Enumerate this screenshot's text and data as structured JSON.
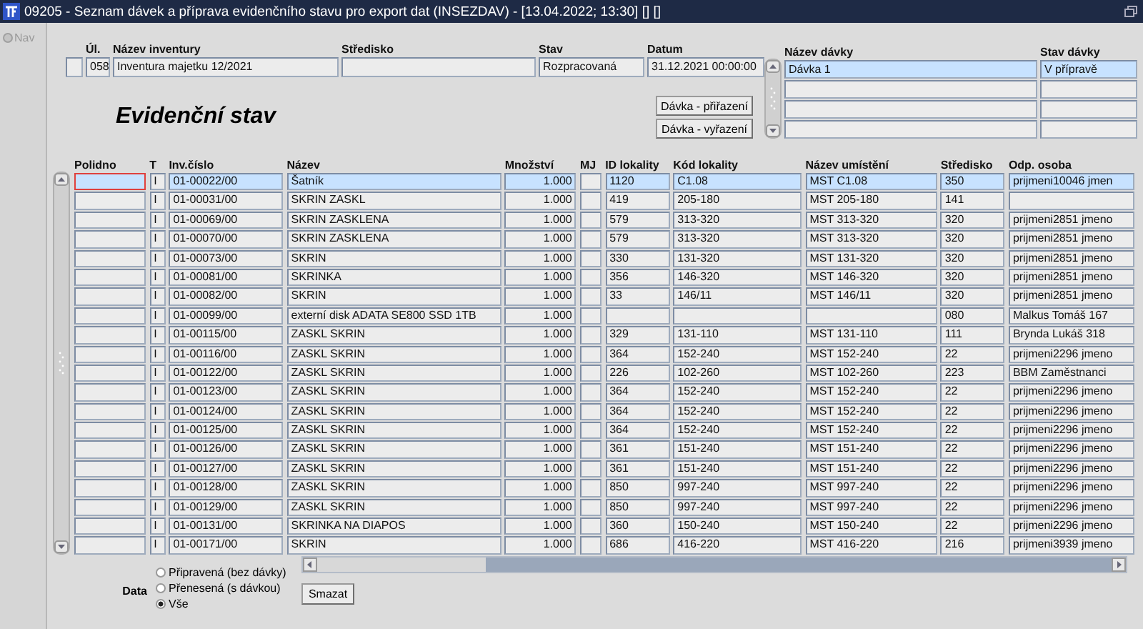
{
  "window": {
    "title": "09205 - Seznam dávek a příprava evidenčního stavu pro export dat (INSEZDAV) - [13.04.2022; 13:30] [] []"
  },
  "sidebar": {
    "items": [
      {
        "label": "Nav"
      }
    ]
  },
  "inventory": {
    "columns": [
      "Úl.",
      "Název inventury",
      "Středisko",
      "Stav",
      "Datum"
    ],
    "row": {
      "ul": "058",
      "nazev": "Inventura majetku 12/2021",
      "stav": "Rozpracovaná",
      "datum": "31.12.2021 00:00:00"
    }
  },
  "section_title": "Evidenční stav",
  "buttons": [
    "Dávka - přiřazení",
    "Dávka - vyřazení"
  ],
  "batches": {
    "columns": [
      "Název dávky",
      "Stav dávky"
    ],
    "rows": [
      {
        "name": "Dávka 1",
        "status": "V přípravě",
        "selected": true
      }
    ]
  },
  "table": {
    "columns": [
      "Polidno",
      "T",
      "Inv.číslo",
      "Název",
      "Množství",
      "MJ",
      "ID lokality",
      "Kód lokality",
      "Název umístění",
      "Středisko",
      "Odp. osoba"
    ],
    "rows": [
      {
        "selected": true,
        "t": "I",
        "inv_cislo": "01-00022/00",
        "nazev": "Šatník",
        "mnozstvi": "1.000",
        "id_lokality": "1120",
        "kod_lokality": "C1.08",
        "nazev_umisteni": "MST C1.08",
        "stredisko": "350",
        "odp_osoba": "prijmeni10046 jmen"
      },
      {
        "selected": false,
        "t": "I",
        "inv_cislo": "01-00031/00",
        "nazev": "SKRIN ZASKL",
        "mnozstvi": "1.000",
        "id_lokality": "419",
        "kod_lokality": "205-180",
        "nazev_umisteni": "MST 205-180",
        "stredisko": "141"
      },
      {
        "selected": false,
        "t": "I",
        "inv_cislo": "01-00069/00",
        "nazev": "SKRIN ZASKLENA",
        "mnozstvi": "1.000",
        "id_lokality": "579",
        "kod_lokality": "313-320",
        "nazev_umisteni": "MST 313-320",
        "stredisko": "320",
        "odp_osoba": "prijmeni2851 jmeno"
      },
      {
        "selected": false,
        "t": "I",
        "inv_cislo": "01-00070/00",
        "nazev": "SKRIN ZASKLENA",
        "mnozstvi": "1.000",
        "id_lokality": "579",
        "kod_lokality": "313-320",
        "nazev_umisteni": "MST 313-320",
        "stredisko": "320",
        "odp_osoba": "prijmeni2851 jmeno"
      },
      {
        "selected": false,
        "t": "I",
        "inv_cislo": "01-00073/00",
        "nazev": "SKRIN",
        "mnozstvi": "1.000",
        "id_lokality": "330",
        "kod_lokality": "131-320",
        "nazev_umisteni": "MST 131-320",
        "stredisko": "320",
        "odp_osoba": "prijmeni2851 jmeno"
      },
      {
        "selected": false,
        "t": "I",
        "inv_cislo": "01-00081/00",
        "nazev": "SKRINKA",
        "mnozstvi": "1.000",
        "id_lokality": "356",
        "kod_lokality": "146-320",
        "nazev_umisteni": "MST 146-320",
        "stredisko": "320",
        "odp_osoba": "prijmeni2851 jmeno"
      },
      {
        "selected": false,
        "t": "I",
        "inv_cislo": "01-00082/00",
        "nazev": "SKRIN",
        "mnozstvi": "1.000",
        "id_lokality": "33",
        "kod_lokality": "146/11",
        "nazev_umisteni": "MST 146/11",
        "stredisko": "320",
        "odp_osoba": "prijmeni2851 jmeno"
      },
      {
        "selected": false,
        "t": "I",
        "inv_cislo": "01-00099/00",
        "nazev": "externí disk ADATA SE800 SSD 1TB",
        "mnozstvi": "1.000",
        "stredisko": "080",
        "odp_osoba": "Malkus Tomáš 167"
      },
      {
        "selected": false,
        "t": "I",
        "inv_cislo": "01-00115/00",
        "nazev": "ZASKL SKRIN",
        "mnozstvi": "1.000",
        "id_lokality": "329",
        "kod_lokality": "131-110",
        "nazev_umisteni": "MST 131-110",
        "stredisko": "111",
        "odp_osoba": "Brynda Lukáš 318"
      },
      {
        "selected": false,
        "t": "I",
        "inv_cislo": "01-00116/00",
        "nazev": "ZASKL SKRIN",
        "mnozstvi": "1.000",
        "id_lokality": "364",
        "kod_lokality": "152-240",
        "nazev_umisteni": "MST 152-240",
        "stredisko": "22",
        "odp_osoba": "prijmeni2296 jmeno"
      },
      {
        "selected": false,
        "t": "I",
        "inv_cislo": "01-00122/00",
        "nazev": "ZASKL SKRIN",
        "mnozstvi": "1.000",
        "id_lokality": "226",
        "kod_lokality": "102-260",
        "nazev_umisteni": "MST 102-260",
        "stredisko": "223",
        "odp_osoba": "BBM Zaměstnanci"
      },
      {
        "selected": false,
        "t": "I",
        "inv_cislo": "01-00123/00",
        "nazev": "ZASKL SKRIN",
        "mnozstvi": "1.000",
        "id_lokality": "364",
        "kod_lokality": "152-240",
        "nazev_umisteni": "MST 152-240",
        "stredisko": "22",
        "odp_osoba": "prijmeni2296 jmeno"
      },
      {
        "selected": false,
        "t": "I",
        "inv_cislo": "01-00124/00",
        "nazev": "ZASKL SKRIN",
        "mnozstvi": "1.000",
        "id_lokality": "364",
        "kod_lokality": "152-240",
        "nazev_umisteni": "MST 152-240",
        "stredisko": "22",
        "odp_osoba": "prijmeni2296 jmeno"
      },
      {
        "selected": false,
        "t": "I",
        "inv_cislo": "01-00125/00",
        "nazev": "ZASKL SKRIN",
        "mnozstvi": "1.000",
        "id_lokality": "364",
        "kod_lokality": "152-240",
        "nazev_umisteni": "MST 152-240",
        "stredisko": "22",
        "odp_osoba": "prijmeni2296 jmeno"
      },
      {
        "selected": false,
        "t": "I",
        "inv_cislo": "01-00126/00",
        "nazev": "ZASKL SKRIN",
        "mnozstvi": "1.000",
        "id_lokality": "361",
        "kod_lokality": "151-240",
        "nazev_umisteni": "MST 151-240",
        "stredisko": "22",
        "odp_osoba": "prijmeni2296 jmeno"
      },
      {
        "selected": false,
        "t": "I",
        "inv_cislo": "01-00127/00",
        "nazev": "ZASKL SKRIN",
        "mnozstvi": "1.000",
        "id_lokality": "361",
        "kod_lokality": "151-240",
        "nazev_umisteni": "MST 151-240",
        "stredisko": "22",
        "odp_osoba": "prijmeni2296 jmeno"
      },
      {
        "selected": false,
        "t": "I",
        "inv_cislo": "01-00128/00",
        "nazev": "ZASKL SKRIN",
        "mnozstvi": "1.000",
        "id_lokality": "850",
        "kod_lokality": "997-240",
        "nazev_umisteni": "MST 997-240",
        "stredisko": "22",
        "odp_osoba": "prijmeni2296 jmeno"
      },
      {
        "selected": false,
        "t": "I",
        "inv_cislo": "01-00129/00",
        "nazev": "ZASKL SKRIN",
        "mnozstvi": "1.000",
        "id_lokality": "850",
        "kod_lokality": "997-240",
        "nazev_umisteni": "MST 997-240",
        "stredisko": "22",
        "odp_osoba": "prijmeni2296 jmeno"
      },
      {
        "selected": false,
        "t": "I",
        "inv_cislo": "01-00131/00",
        "nazev": "SKRINKA NA DIAPOS",
        "mnozstvi": "1.000",
        "id_lokality": "360",
        "kod_lokality": "150-240",
        "nazev_umisteni": "MST 150-240",
        "stredisko": "22",
        "odp_osoba": "prijmeni2296 jmeno"
      },
      {
        "selected": false,
        "t": "I",
        "inv_cislo": "01-00171/00",
        "nazev": "SKRIN",
        "mnozstvi": "1.000",
        "id_lokality": "686",
        "kod_lokality": "416-220",
        "nazev_umisteni": "MST 416-220",
        "stredisko": "216",
        "odp_osoba": "prijmeni3939 jmeno"
      }
    ]
  },
  "filter": {
    "label": "Data",
    "options": [
      {
        "label": "Připravená (bez dávky)",
        "selected": false
      },
      {
        "label": "Přenesená (s dávkou)",
        "selected": false
      },
      {
        "label": "Vše",
        "selected": true
      }
    ]
  },
  "delete_button": "Smazat"
}
